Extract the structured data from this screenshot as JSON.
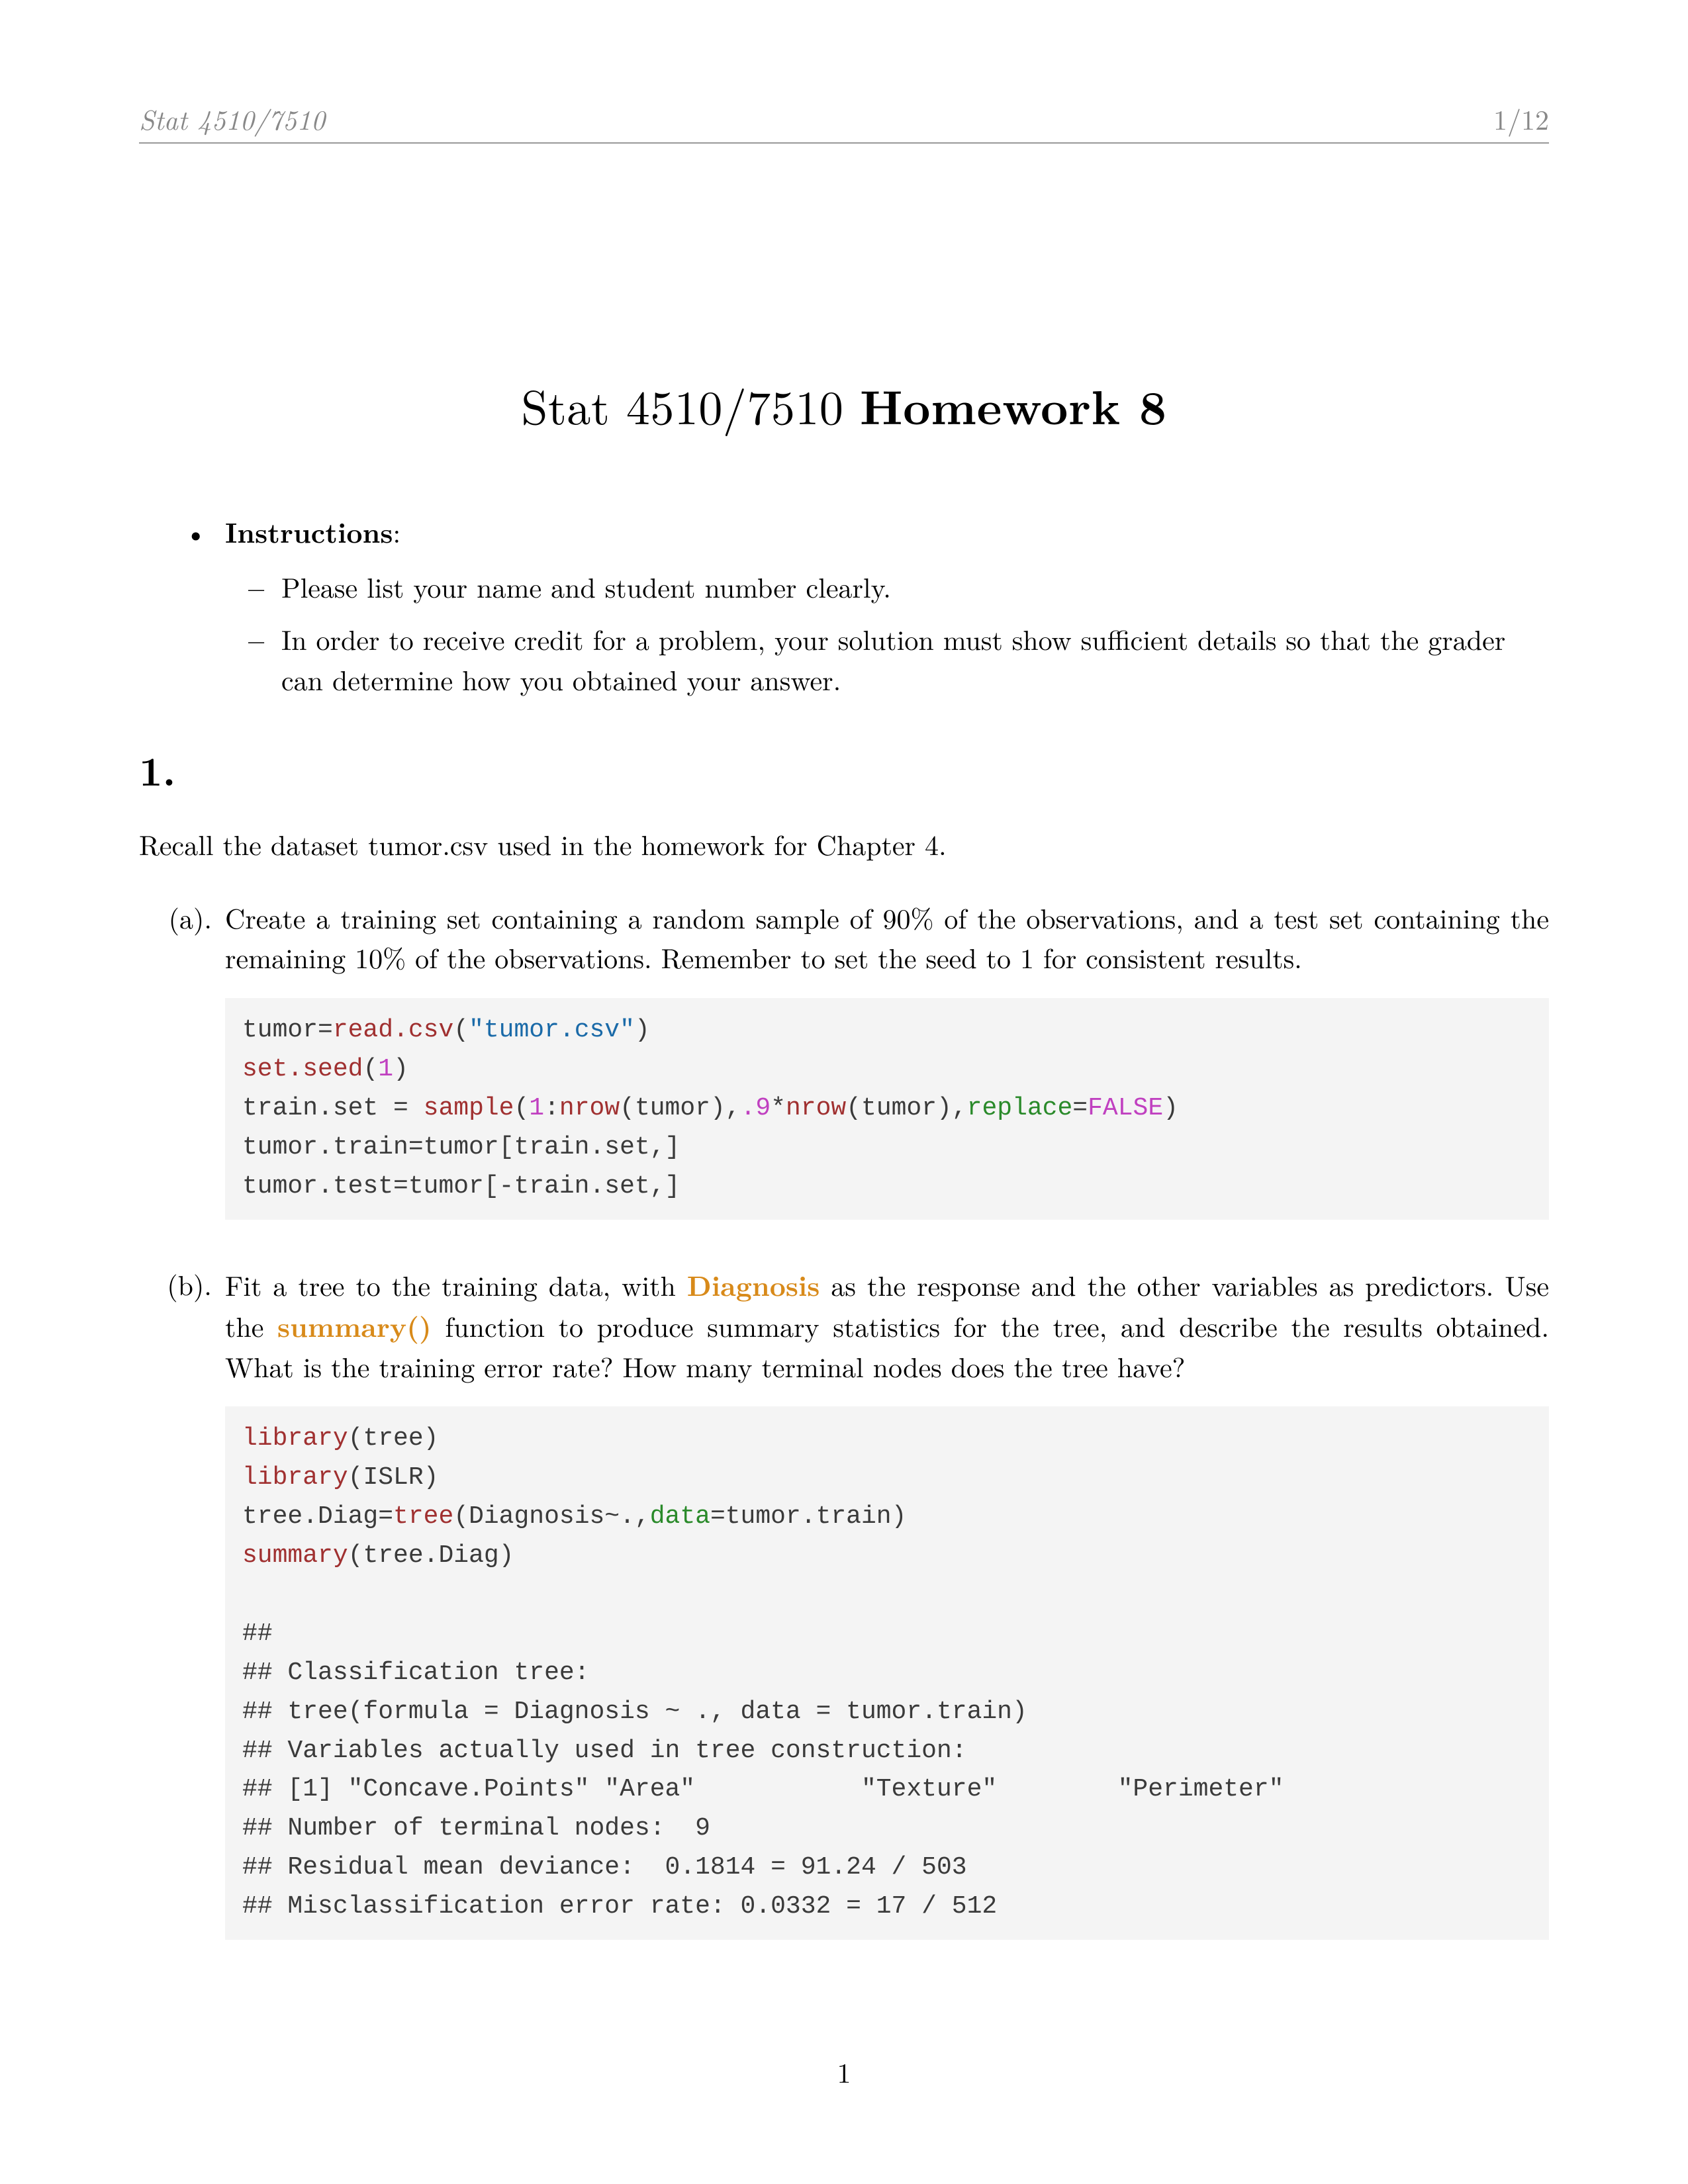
{
  "header": {
    "left": "Stat 4510/7510",
    "right": "1/12"
  },
  "title": {
    "prefix": "Stat 4510/7510 ",
    "bold": "Homework 8"
  },
  "instructions": {
    "label": "Instructions",
    "items": [
      "Please list your name and student number clearly.",
      "In order to receive credit for a problem, your solution must show sufficient details so that the grader can determine how you obtained your answer."
    ]
  },
  "section1": {
    "num": "1.",
    "intro": "Recall the dataset tumor.csv used in the homework for Chapter 4.",
    "a": {
      "label": "(a).",
      "text": "Create a training set containing a random sample of 90% of the observations, and a test set containing the remaining 10% of the observations. Remember to set the seed to 1 for consistent results.",
      "code": {
        "l1a": "tumor=",
        "l1b": "read.csv",
        "l1c": "(",
        "l1d": "\"tumor.csv\"",
        "l1e": ")",
        "l2a": "set.seed",
        "l2b": "(",
        "l2c": "1",
        "l2d": ")",
        "l3a": "train.set = ",
        "l3b": "sample",
        "l3c": "(",
        "l3d": "1",
        "l3e": ":",
        "l3f": "nrow",
        "l3g": "(tumor),",
        "l3h": ".9",
        "l3i": "*",
        "l3j": "nrow",
        "l3k": "(tumor),",
        "l3l": "replace",
        "l3m": "=",
        "l3n": "FALSE",
        "l3o": ")",
        "l4": "tumor.train=tumor[train.set,]",
        "l5": "tumor.test=tumor[-train.set,]"
      }
    },
    "b": {
      "label": "(b).",
      "text_pre": "Fit a tree to the training data, with ",
      "hl1": "Diagnosis",
      "text_mid": " as the response and the other variables as predictors. Use the ",
      "hl2": "summary()",
      "text_post": " function to produce summary statistics for the tree, and describe the results obtained. What is the training error rate? How many terminal nodes does the tree have?",
      "code": {
        "l1a": "library",
        "l1b": "(tree)",
        "l2a": "library",
        "l2b": "(ISLR)",
        "l3a": "tree.Diag=",
        "l3b": "tree",
        "l3c": "(Diagnosis~.,",
        "l3d": "data",
        "l3e": "=tumor.train)",
        "l4a": "summary",
        "l4b": "(tree.Diag)",
        "out1": "##",
        "out2": "## Classification tree:",
        "out3": "## tree(formula = Diagnosis ~ ., data = tumor.train)",
        "out4": "## Variables actually used in tree construction:",
        "out5": "## [1] \"Concave.Points\" \"Area\"           \"Texture\"        \"Perimeter\"",
        "out6": "## Number of terminal nodes:  9",
        "out7": "## Residual mean deviance:  0.1814 = 91.24 / 503",
        "out8": "## Misclassification error rate: 0.0332 = 17 / 512"
      }
    }
  },
  "footer": {
    "pagenum": "1"
  }
}
